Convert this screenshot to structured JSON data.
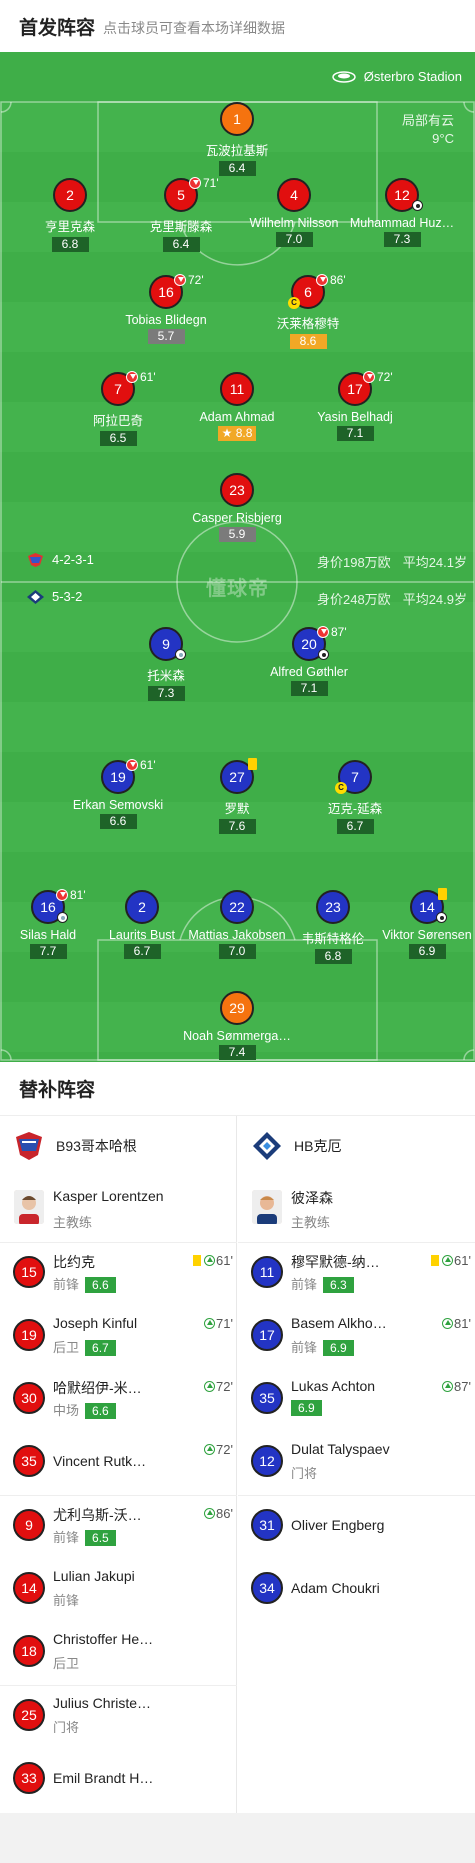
{
  "header": {
    "title": "首发阵容",
    "subtitle": "点击球员可查看本场详细数据"
  },
  "venue": "Østerbro Stadion",
  "weather": {
    "condition": "局部有云",
    "temp": "9°C"
  },
  "home": {
    "formation": "4-2-3-1",
    "value_label": "身价198万欧",
    "age_label": "平均24.1岁",
    "color": "#e10f0f"
  },
  "away": {
    "formation": "5-3-2",
    "value_label": "身价248万欧",
    "age_label": "平均24.9岁",
    "color": "#2334c4"
  },
  "watermark": "懂球帝",
  "home_players": [
    {
      "num": "1",
      "name": "瓦波拉基斯",
      "rating": "6.4"
    },
    {
      "num": "2",
      "name": "亨里克森",
      "rating": "6.8"
    },
    {
      "num": "5",
      "name": "克里斯滕森",
      "rating": "6.4",
      "sub": "71'"
    },
    {
      "num": "4",
      "name": "Wilhelm Nilsson",
      "rating": "7.0"
    },
    {
      "num": "12",
      "name": "Muhammad Huz…",
      "rating": "7.3"
    },
    {
      "num": "16",
      "name": "Tobias Blidegn",
      "rating": "5.7",
      "sub": "72'"
    },
    {
      "num": "6",
      "name": "沃莱格穆特",
      "rating": "8.6",
      "sub": "86'"
    },
    {
      "num": "7",
      "name": "阿拉巴奇",
      "rating": "6.5",
      "sub": "61'"
    },
    {
      "num": "11",
      "name": "Adam Ahmad",
      "rating": "8.8"
    },
    {
      "num": "17",
      "name": "Yasin Belhadj",
      "rating": "7.1",
      "sub": "72'"
    },
    {
      "num": "23",
      "name": "Casper Risbjerg",
      "rating": "5.9"
    }
  ],
  "away_players": [
    {
      "num": "9",
      "name": "托米森",
      "rating": "7.3"
    },
    {
      "num": "20",
      "name": "Alfred Gøthler",
      "rating": "7.1",
      "sub": "87'"
    },
    {
      "num": "19",
      "name": "Erkan Semovski",
      "rating": "6.6",
      "sub": "61'"
    },
    {
      "num": "27",
      "name": "罗默",
      "rating": "7.6"
    },
    {
      "num": "7",
      "name": "迈克-延森",
      "rating": "6.7"
    },
    {
      "num": "16",
      "name": "Silas Hald",
      "rating": "7.7",
      "sub": "81'"
    },
    {
      "num": "2",
      "name": "Laurits Bust",
      "rating": "6.7"
    },
    {
      "num": "22",
      "name": "Mattias Jakobsen",
      "rating": "7.0"
    },
    {
      "num": "23",
      "name": "韦斯特格伦",
      "rating": "6.8"
    },
    {
      "num": "14",
      "name": "Viktor Sørensen",
      "rating": "6.9"
    },
    {
      "num": "29",
      "name": "Noah Sømmerga…",
      "rating": "7.4"
    }
  ],
  "bench": {
    "title": "替补阵容",
    "home_team": "B93哥本哈根",
    "away_team": "HB克厄",
    "home_coach": {
      "name": "Kasper Lorentzen",
      "role": "主教练"
    },
    "away_coach": {
      "name": "彼泽森",
      "role": "主教练"
    },
    "home_subs": [
      {
        "num": "15",
        "name": "比约克",
        "pos": "前锋",
        "rating": "6.6",
        "event": "61'"
      },
      {
        "num": "19",
        "name": "Joseph Kinful",
        "pos": "后卫",
        "rating": "6.7",
        "event": "71'"
      },
      {
        "num": "30",
        "name": "哈默绍伊-米…",
        "pos": "中场",
        "rating": "6.6",
        "event": "72'"
      },
      {
        "num": "35",
        "name": "Vincent Rutk…",
        "pos": "",
        "rating": "",
        "event": "72'"
      },
      {
        "num": "9",
        "name": "尤利乌斯-沃…",
        "pos": "前锋",
        "rating": "6.5",
        "event": "86'"
      },
      {
        "num": "14",
        "name": "Lulian Jakupi",
        "pos": "前锋",
        "rating": "",
        "event": ""
      },
      {
        "num": "18",
        "name": "Christoffer He…",
        "pos": "后卫",
        "rating": "",
        "event": ""
      },
      {
        "num": "25",
        "name": "Julius Christe…",
        "pos": "门将",
        "rating": "",
        "event": ""
      },
      {
        "num": "33",
        "name": "Emil Brandt H…",
        "pos": "",
        "rating": "",
        "event": ""
      }
    ],
    "away_subs": [
      {
        "num": "11",
        "name": "穆罕默德-纳…",
        "pos": "前锋",
        "rating": "6.3",
        "event": "61'"
      },
      {
        "num": "17",
        "name": "Basem Alkho…",
        "pos": "前锋",
        "rating": "6.9",
        "event": "81'"
      },
      {
        "num": "35",
        "name": "Lukas Achton",
        "pos": "",
        "rating": "6.9",
        "event": "87'"
      },
      {
        "num": "12",
        "name": "Dulat Talyspaev",
        "pos": "门将",
        "rating": "",
        "event": ""
      },
      {
        "num": "31",
        "name": "Oliver Engberg",
        "pos": "",
        "rating": "",
        "event": ""
      },
      {
        "num": "34",
        "name": "Adam Choukri",
        "pos": "",
        "rating": "",
        "event": ""
      }
    ]
  }
}
